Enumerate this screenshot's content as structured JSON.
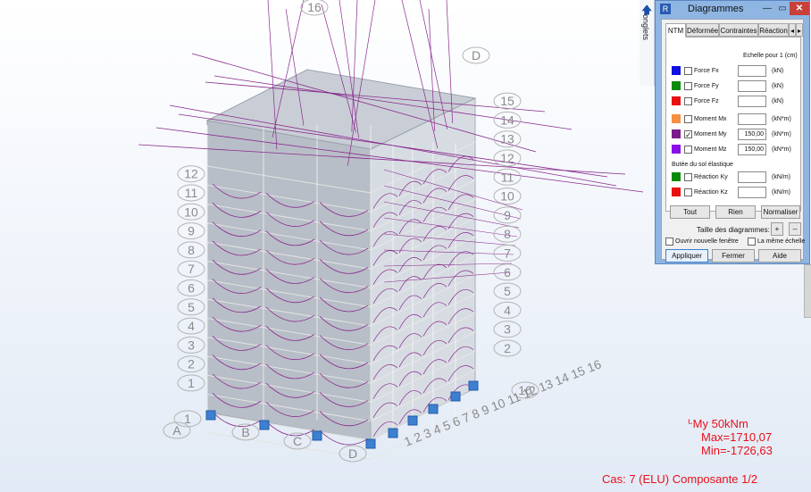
{
  "viewport": {
    "axes_top": [
      "1",
      "2",
      "3",
      "4",
      "5",
      "6",
      "7",
      "8",
      "9",
      "10",
      "11",
      "12",
      "13",
      "14",
      "15",
      "16"
    ],
    "levels": [
      "1",
      "2",
      "3",
      "4",
      "5",
      "6",
      "7",
      "8",
      "9",
      "10",
      "11",
      "12",
      "13",
      "14",
      "15"
    ],
    "levels_right": [
      "2",
      "3",
      "4",
      "5",
      "6",
      "7",
      "8",
      "9",
      "10",
      "11",
      "12",
      "13",
      "14",
      "15"
    ],
    "axes_letters": [
      "A",
      "B",
      "C",
      "D"
    ],
    "top_axis_label": "16",
    "top_letter": "D",
    "axes_bottom_right": "1 2 3 4 5 6 7 8 9 10 11 12 13 14 15 16",
    "axes_bottom_right_num": "16",
    "colors": {
      "building": "#b8bec7",
      "diagram": "#8a2a8e",
      "support": "#3d7fd1",
      "level_label": "#8a8a8a"
    }
  },
  "side_strip": {
    "label": "onglets",
    "icon": "pin-arrow-icon"
  },
  "dialog": {
    "title": "Diagrammes",
    "app_icon": "robot-icon",
    "min_glyph": "—",
    "max_glyph": "▭",
    "close_glyph": "✕",
    "tabs": [
      "NTM",
      "Déformée",
      "Contraintes",
      "Réaction"
    ],
    "tab_nav": [
      "◂",
      "▸"
    ],
    "scale_header": "Echelle pour 1  (cm)",
    "items": [
      {
        "label": "Force Fx",
        "color": "#1010e0",
        "checked": false,
        "value": "",
        "unit": "(kN)"
      },
      {
        "label": "Force Fy",
        "color": "#0a8a0a",
        "checked": false,
        "value": "",
        "unit": "(kN)"
      },
      {
        "label": "Force Fz",
        "color": "#e81010",
        "checked": false,
        "value": "",
        "unit": "(kN)"
      },
      {
        "label": "Moment Mx",
        "color": "#f79040",
        "checked": false,
        "value": "",
        "unit": "(kN*m)"
      },
      {
        "label": "Moment My",
        "color": "#7a1a8a",
        "checked": true,
        "value": "150,00",
        "unit": "(kN*m)"
      },
      {
        "label": "Moment Mz",
        "color": "#8a10e8",
        "checked": false,
        "value": "150,00",
        "unit": "(kN*m)"
      }
    ],
    "soil_section": "Butée du sol élastique",
    "soil_items": [
      {
        "label": "Réaction Ky",
        "color": "#0a8a0a",
        "checked": false,
        "value": "",
        "unit": "(kN/m)"
      },
      {
        "label": "Réaction Kz",
        "color": "#e81010",
        "checked": false,
        "value": "",
        "unit": "(kN/m)"
      }
    ],
    "buttons": [
      "Tout",
      "Rien",
      "Normaliser"
    ],
    "size_label": "Taille des diagrammes:",
    "size_plus": "+",
    "size_minus": "--",
    "open_window": "Ouvrir nouvelle fenêtre",
    "same_scale": "La même échelle",
    "bottom_buttons": [
      "Appliquer",
      "Fermer",
      "Aide"
    ]
  },
  "legend": {
    "icon_glyph": "ᒡ",
    "line1": "My  50kNm",
    "max": "Max=1710,07",
    "min": "Min=-1726,63",
    "case": "Cas: 7 (ELU) Composante 1/2"
  }
}
